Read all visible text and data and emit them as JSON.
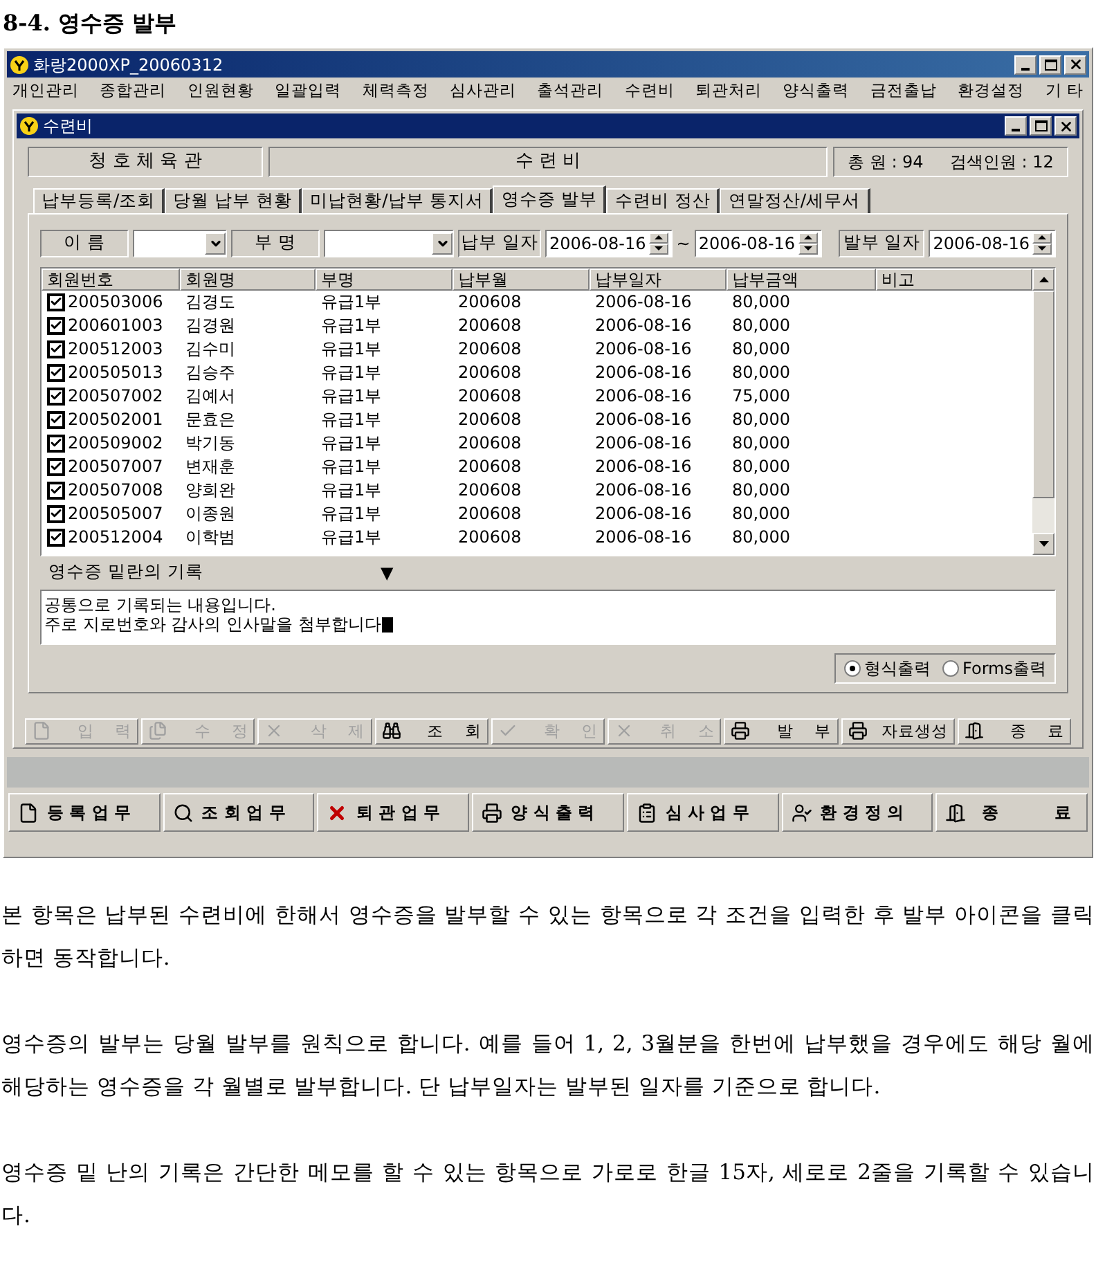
{
  "heading": "8-4. 영수증 발부",
  "app": {
    "title": "화랑2000XP_20060312",
    "menu": [
      "개인관리",
      "종합관리",
      "인원현황",
      "일괄입력",
      "체력측정",
      "심사관리",
      "출석관리",
      "수련비",
      "퇴관처리",
      "양식출력",
      "금전출납",
      "환경설정",
      "기 타"
    ],
    "child": {
      "title": "수련비",
      "header": {
        "org": "청 호 체 육 관",
        "module": "수 련 비",
        "total": "총 원 : 94",
        "search_count": "검색인원 : 12"
      },
      "tabs": [
        {
          "label": "납부등록/조회",
          "selected": false
        },
        {
          "label": "당월 납부 현황",
          "selected": false
        },
        {
          "label": "미납현황/납부 통지서",
          "selected": false
        },
        {
          "label": "영수증 발부",
          "selected": true
        },
        {
          "label": "수련비 정산",
          "selected": false
        },
        {
          "label": "연말정산/세무서",
          "selected": false
        }
      ],
      "filters": {
        "name_label": "이 름",
        "dept_label": "부 명",
        "pay_date_label": "납부 일자",
        "from": "2006-08-16",
        "tilde": "~",
        "to": "2006-08-16",
        "issue_date_label": "발부 일자",
        "issue_date": "2006-08-16"
      },
      "table": {
        "columns": [
          "회원번호",
          "회원명",
          "부명",
          "납부월",
          "납부일자",
          "납부금액",
          "비고"
        ],
        "rows": [
          {
            "checked": true,
            "cells": [
              "200503006",
              "김경도",
              "유급1부",
              "200608",
              "2006-08-16",
              "80,000"
            ]
          },
          {
            "checked": true,
            "cells": [
              "200601003",
              "김경원",
              "유급1부",
              "200608",
              "2006-08-16",
              "80,000"
            ]
          },
          {
            "checked": true,
            "cells": [
              "200512003",
              "김수미",
              "유급1부",
              "200608",
              "2006-08-16",
              "80,000"
            ]
          },
          {
            "checked": true,
            "cells": [
              "200505013",
              "김승주",
              "유급1부",
              "200608",
              "2006-08-16",
              "80,000"
            ]
          },
          {
            "checked": true,
            "cells": [
              "200507002",
              "김예서",
              "유급1부",
              "200608",
              "2006-08-16",
              "75,000"
            ]
          },
          {
            "checked": true,
            "cells": [
              "200502001",
              "문효은",
              "유급1부",
              "200608",
              "2006-08-16",
              "80,000"
            ]
          },
          {
            "checked": true,
            "cells": [
              "200509002",
              "박기동",
              "유급1부",
              "200608",
              "2006-08-16",
              "80,000"
            ]
          },
          {
            "checked": true,
            "cells": [
              "200507007",
              "변재훈",
              "유급1부",
              "200608",
              "2006-08-16",
              "80,000"
            ]
          },
          {
            "checked": true,
            "cells": [
              "200507008",
              "양희완",
              "유급1부",
              "200608",
              "2006-08-16",
              "80,000"
            ]
          },
          {
            "checked": true,
            "cells": [
              "200505007",
              "이종원",
              "유급1부",
              "200608",
              "2006-08-16",
              "80,000"
            ]
          },
          {
            "checked": true,
            "cells": [
              "200512004",
              "이학범",
              "유급1부",
              "200608",
              "2006-08-16",
              "80,000"
            ]
          }
        ]
      },
      "memo": {
        "label": "영수증 밑란의 기록",
        "arrow": "▼",
        "lines": [
          "공통으로 기록되는 내용입니다.",
          "주로 지로번호와 감사의 인사말을 첨부합니다"
        ]
      },
      "output_options": [
        {
          "label": "형식출력",
          "selected": true
        },
        {
          "label": "Forms출력",
          "selected": false
        }
      ],
      "buttons": [
        {
          "kind": "file",
          "label": "입 력",
          "disabled": true
        },
        {
          "kind": "files",
          "label": "수 정",
          "disabled": true
        },
        {
          "kind": "delete",
          "label": "삭 제",
          "disabled": true
        },
        {
          "kind": "search",
          "label": "조 회",
          "disabled": false
        },
        {
          "kind": "confirm",
          "label": "확 인",
          "disabled": true
        },
        {
          "kind": "cancel",
          "label": "취 소",
          "disabled": true
        },
        {
          "kind": "print",
          "label": "발 부",
          "disabled": false
        },
        {
          "kind": "print",
          "label": "자료생성",
          "disabled": false
        },
        {
          "kind": "exit",
          "label": "종 료",
          "disabled": false
        }
      ]
    },
    "taskbar": [
      {
        "kind": "file",
        "label": "등 록 업 무"
      },
      {
        "kind": "search",
        "label": "조 회 업 무"
      },
      {
        "kind": "delete",
        "label": "퇴 관 업 무"
      },
      {
        "kind": "print",
        "label": "양 식 출 력"
      },
      {
        "kind": "form",
        "label": "심 사 업 무"
      },
      {
        "kind": "user",
        "label": "환 경 정 의"
      },
      {
        "kind": "exit",
        "label": "종 료"
      }
    ]
  },
  "paragraphs": [
    "본 항목은 납부된 수련비에 한해서 영수증을 발부할 수 있는 항목으로 각 조건을 입력한 후 발부 아이콘을 클릭 하면 동작합니다.",
    "영수증의 발부는 당월 발부를 원칙으로 합니다. 예를 들어 1, 2, 3월분을 한번에 납부했을 경우에도 해당 월에 해당하는 영수증을 각 월별로 발부합니다. 단 납부일자는 발부된 일자를 기준으로 합니다.",
    "영수증 밑 난의 기록은 간단한 메모를 할 수 있는 항목으로 가로로 한글 15자, 세로로 2줄을 기록할 수 있습니다."
  ]
}
